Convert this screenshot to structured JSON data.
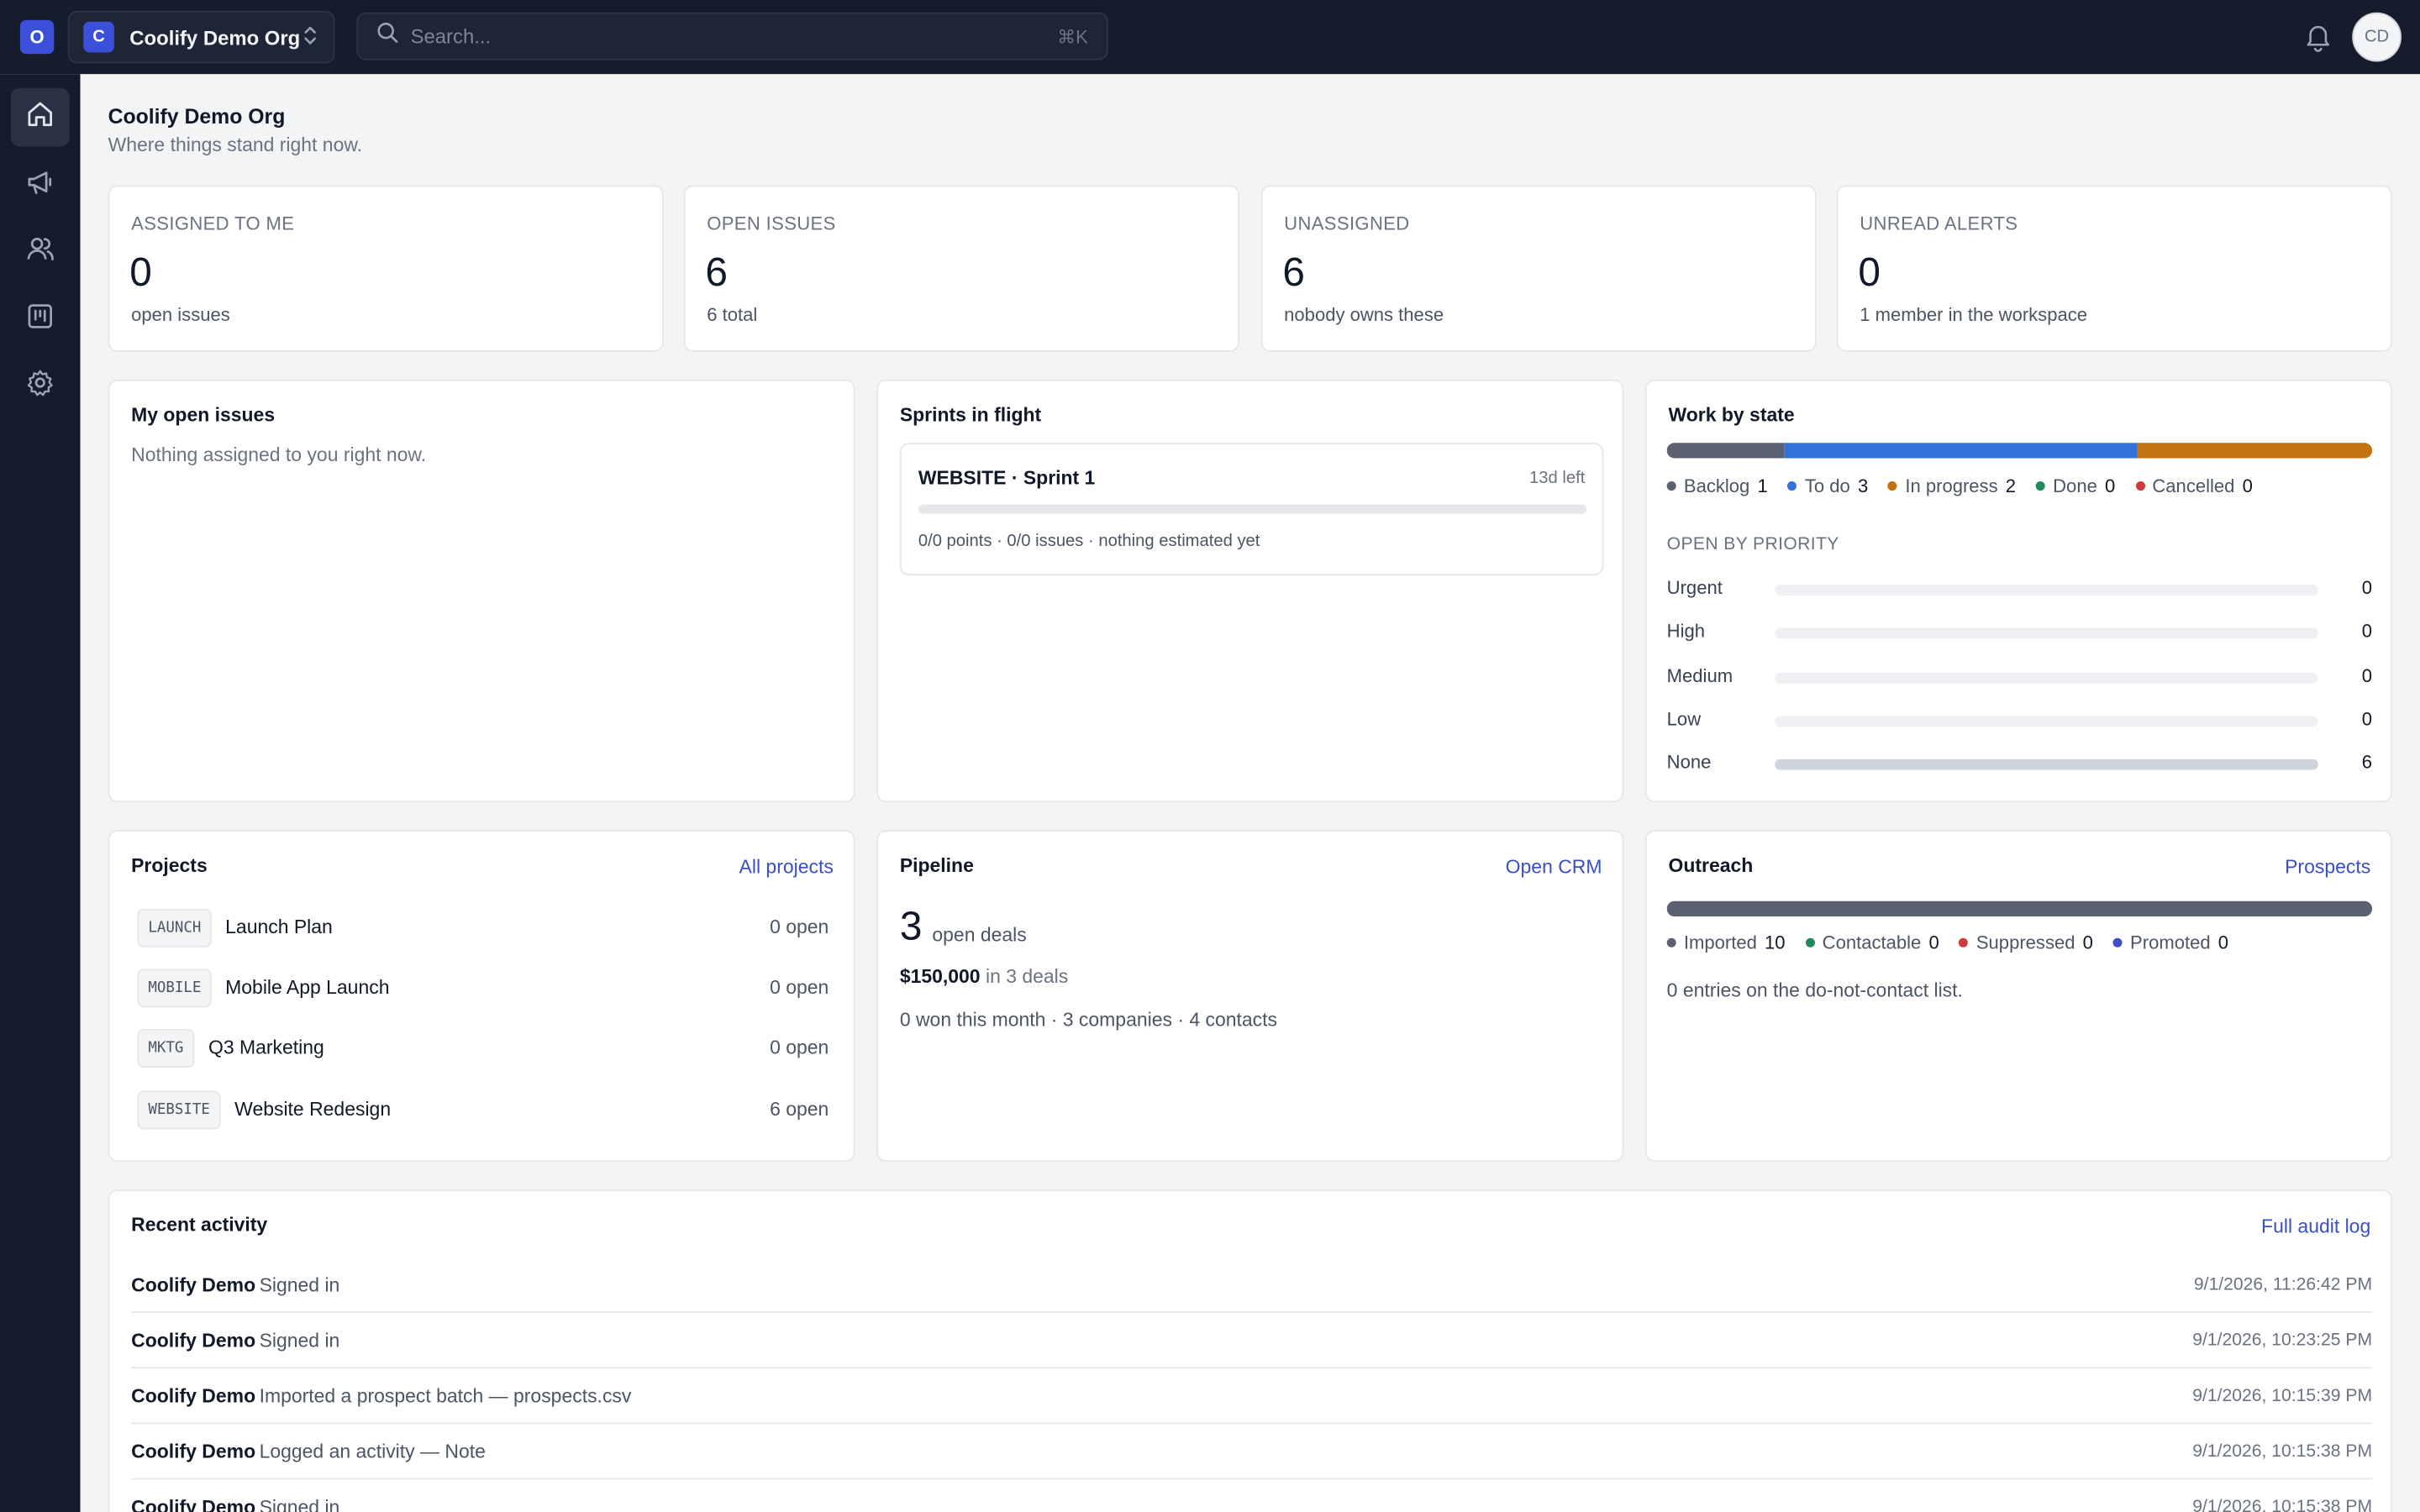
{
  "topbar": {
    "brand_letter": "O",
    "org_letter": "C",
    "org_name": "Coolify Demo Org",
    "search_placeholder": "Search...",
    "search_shortcut": "⌘K",
    "avatar_initials": "CD"
  },
  "sidebar": {
    "items": [
      {
        "icon": "home-icon",
        "active": true
      },
      {
        "icon": "megaphone-icon",
        "active": false
      },
      {
        "icon": "users-icon",
        "active": false
      },
      {
        "icon": "board-icon",
        "active": false
      },
      {
        "icon": "gear-icon",
        "active": false
      }
    ]
  },
  "header": {
    "title": "Coolify Demo Org",
    "subtitle": "Where things stand right now."
  },
  "stats": [
    {
      "label": "ASSIGNED TO ME",
      "value": "0",
      "caption": "open issues"
    },
    {
      "label": "OPEN ISSUES",
      "value": "6",
      "caption": "6 total"
    },
    {
      "label": "UNASSIGNED",
      "value": "6",
      "caption": "nobody owns these"
    },
    {
      "label": "UNREAD ALERTS",
      "value": "0",
      "caption": "1 member in the workspace"
    }
  ],
  "my_issues": {
    "title": "My open issues",
    "empty": "Nothing assigned to you right now."
  },
  "sprints": {
    "title": "Sprints in flight",
    "items": [
      {
        "name": "WEBSITE · Sprint 1",
        "remaining": "13d left",
        "meta": "0/0 points · 0/0 issues · nothing estimated yet",
        "progress": 0
      }
    ]
  },
  "work_by_state": {
    "title": "Work by state",
    "states": [
      {
        "name": "Backlog",
        "count": "1",
        "color": "#5b6170"
      },
      {
        "name": "To do",
        "count": "3",
        "color": "#3272d9"
      },
      {
        "name": "In progress",
        "count": "2",
        "color": "#c2720f"
      },
      {
        "name": "Done",
        "count": "0",
        "color": "#1f8a5b"
      },
      {
        "name": "Cancelled",
        "count": "0",
        "color": "#d03a3a"
      }
    ],
    "priority_heading": "OPEN BY PRIORITY",
    "priorities": [
      {
        "name": "Urgent",
        "count": "0",
        "fraction": 0
      },
      {
        "name": "High",
        "count": "0",
        "fraction": 0
      },
      {
        "name": "Medium",
        "count": "0",
        "fraction": 0
      },
      {
        "name": "Low",
        "count": "0",
        "fraction": 0
      },
      {
        "name": "None",
        "count": "6",
        "fraction": 1
      }
    ]
  },
  "projects": {
    "title": "Projects",
    "link": "All projects",
    "items": [
      {
        "key": "LAUNCH",
        "name": "Launch Plan",
        "open": "0 open"
      },
      {
        "key": "MOBILE",
        "name": "Mobile App Launch",
        "open": "0 open"
      },
      {
        "key": "MKTG",
        "name": "Q3 Marketing",
        "open": "0 open"
      },
      {
        "key": "WEBSITE",
        "name": "Website Redesign",
        "open": "6 open"
      }
    ]
  },
  "pipeline": {
    "title": "Pipeline",
    "link": "Open CRM",
    "deals_count": "3",
    "deals_label": "open deals",
    "amount": "$150,000",
    "amount_suffix": "in 3 deals",
    "summary": "0 won this month · 3 companies · 4 contacts"
  },
  "outreach": {
    "title": "Outreach",
    "link": "Prospects",
    "states": [
      {
        "name": "Imported",
        "count": "10",
        "color": "#5b6170"
      },
      {
        "name": "Contactable",
        "count": "0",
        "color": "#1f8a5b"
      },
      {
        "name": "Suppressed",
        "count": "0",
        "color": "#d03a3a"
      },
      {
        "name": "Promoted",
        "count": "0",
        "color": "#3b4fc4"
      }
    ],
    "note": "0 entries on the do-not-contact list."
  },
  "activity": {
    "title": "Recent activity",
    "link": "Full audit log",
    "rows": [
      {
        "who": "Coolify Demo",
        "what": "Signed in",
        "when": "9/1/2026, 11:26:42 PM"
      },
      {
        "who": "Coolify Demo",
        "what": "Signed in",
        "when": "9/1/2026, 10:23:25 PM"
      },
      {
        "who": "Coolify Demo",
        "what": "Imported a prospect batch — prospects.csv",
        "when": "9/1/2026, 10:15:39 PM"
      },
      {
        "who": "Coolify Demo",
        "what": "Logged an activity — Note",
        "when": "9/1/2026, 10:15:38 PM"
      },
      {
        "who": "Coolify Demo",
        "what": "Signed in",
        "when": "9/1/2026, 10:15:38 PM"
      }
    ]
  }
}
